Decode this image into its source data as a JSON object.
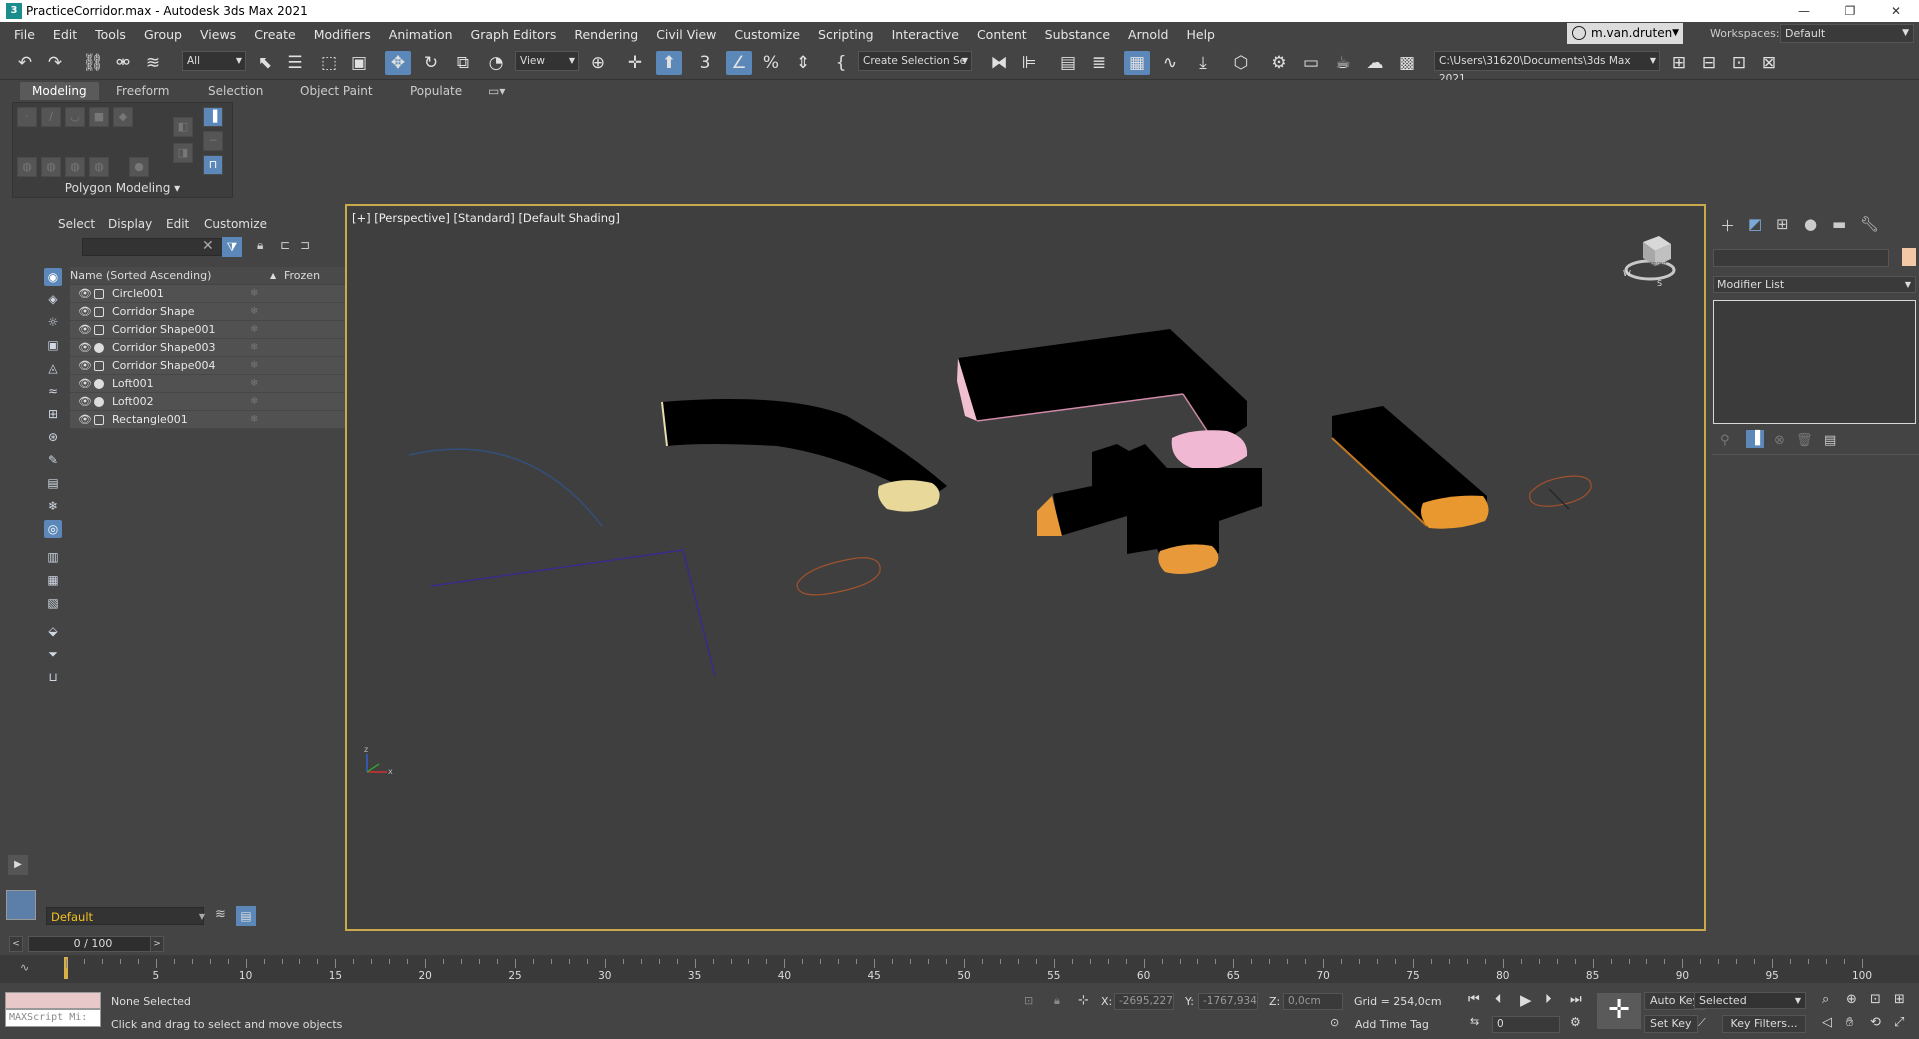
{
  "window": {
    "title": "PracticeCorridor.max - Autodesk 3ds Max 2021",
    "minimize": "—",
    "restore": "❐",
    "close": "✕"
  },
  "menu": [
    "File",
    "Edit",
    "Tools",
    "Group",
    "Views",
    "Create",
    "Modifiers",
    "Animation",
    "Graph Editors",
    "Rendering",
    "Civil View",
    "Customize",
    "Scripting",
    "Interactive",
    "Content",
    "Substance",
    "Arnold",
    "Help"
  ],
  "user": {
    "name": "m.van.druten"
  },
  "workspace": {
    "label": "Workspaces:",
    "value": "Default"
  },
  "toolbar": {
    "filter": "All",
    "refcoord": "View",
    "selection_set": "Create Selection Se",
    "project_path": "C:\\Users\\31620\\Documents\\3ds Max 2021"
  },
  "ribbon": {
    "tabs": [
      "Modeling",
      "Freeform",
      "Selection",
      "Object Paint",
      "Populate"
    ],
    "panel_label": "Polygon Modeling"
  },
  "explorer": {
    "tabs": [
      "Select",
      "Display",
      "Edit",
      "Customize"
    ],
    "col_name": "Name (Sorted Ascending)",
    "col_sort": "▲",
    "col_frozen": "Frozen",
    "rows": [
      {
        "name": "Circle001",
        "type": "shape"
      },
      {
        "name": "Corridor Shape",
        "type": "shape"
      },
      {
        "name": "Corridor Shape001",
        "type": "shape"
      },
      {
        "name": "Corridor Shape003",
        "type": "geo"
      },
      {
        "name": "Corridor Shape004",
        "type": "shape"
      },
      {
        "name": "Loft001",
        "type": "geo"
      },
      {
        "name": "Loft002",
        "type": "geo"
      },
      {
        "name": "Rectangle001",
        "type": "shape"
      }
    ],
    "layer": "Default"
  },
  "viewport": {
    "label": "[+] [Perspective] [Standard] [Default Shading]",
    "viewcube_label": "FRONT",
    "compass": [
      "W",
      "S"
    ],
    "axes": [
      "x",
      "y",
      "z"
    ]
  },
  "command_panel": {
    "modifier_list": "Modifier List",
    "object_color": "#f4c8a6"
  },
  "timeslider": {
    "value": "0 / 100",
    "prev": "<",
    "next": ">"
  },
  "track": {
    "ticks": [
      5,
      10,
      15,
      20,
      25,
      30,
      35,
      40,
      45,
      50,
      55,
      60,
      65,
      70,
      75,
      80,
      85,
      90,
      95,
      100
    ]
  },
  "status": {
    "maxscript_placeholder": "MAXScript Mi:",
    "selection": "None Selected",
    "prompt": "Click and drag to select and move objects",
    "x_label": "X:",
    "x_value": "-2695,227c",
    "y_label": "Y:",
    "y_value": "-1767,934c",
    "z_label": "Z:",
    "z_value": "0,0cm",
    "grid": "Grid = 254,0cm",
    "add_time_tag": "Add Time Tag",
    "auto_key": "Auto Key",
    "set_key": "Set Key",
    "key_mode": "Selected",
    "key_filters": "Key Filters...",
    "frame": "0"
  }
}
